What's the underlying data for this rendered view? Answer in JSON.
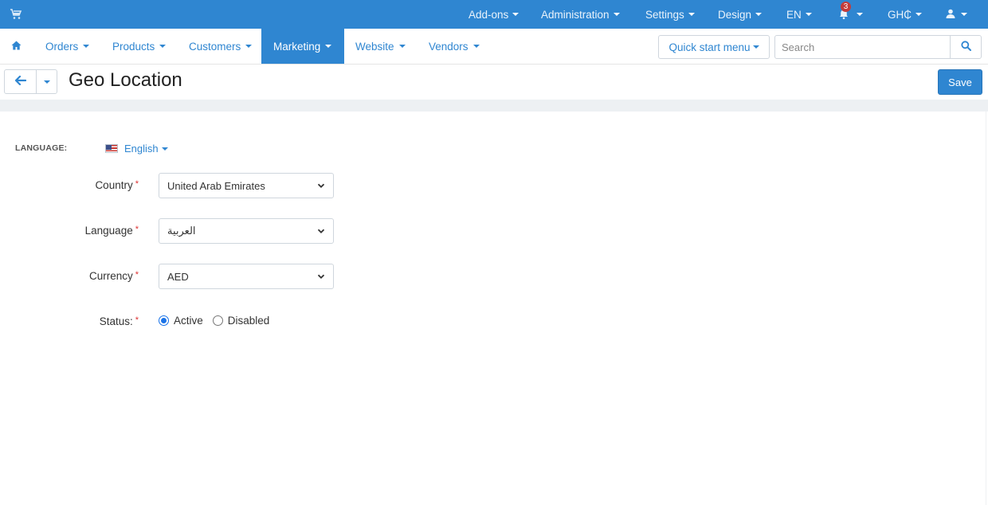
{
  "topbar": {
    "menus": [
      {
        "label": "Add-ons"
      },
      {
        "label": "Administration"
      },
      {
        "label": "Settings"
      },
      {
        "label": "Design"
      },
      {
        "label": "EN"
      },
      {
        "label": "GH₵"
      }
    ],
    "notifications_count": "3"
  },
  "nav": {
    "items": [
      {
        "label": "Orders"
      },
      {
        "label": "Products"
      },
      {
        "label": "Customers"
      },
      {
        "label": "Marketing"
      },
      {
        "label": "Website"
      },
      {
        "label": "Vendors"
      }
    ],
    "active": "Marketing",
    "quick_start": "Quick start menu",
    "search_placeholder": "Search"
  },
  "page": {
    "title": "Geo Location",
    "save_label": "Save"
  },
  "form": {
    "language_switch_label": "LANGUAGE:",
    "language_switch_value": "English",
    "country_label": "Country",
    "country_value": "United Arab Emirates",
    "language_label": "Language",
    "language_value": "العربية",
    "currency_label": "Currency",
    "currency_value": "AED",
    "status_label": "Status:",
    "status_options": [
      "Active",
      "Disabled"
    ],
    "status_selected": "Active",
    "required_mark": "*"
  },
  "colors": {
    "primary": "#2f86d1",
    "required": "#dd3333",
    "badge": "#c43b3b"
  }
}
